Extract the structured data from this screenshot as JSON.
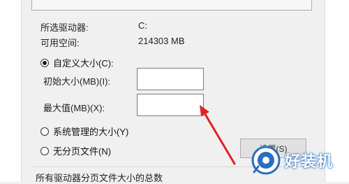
{
  "drive_info": {
    "selected_drive_label": "所选驱动器:",
    "selected_drive_value": "C:",
    "free_space_label": "可用空间:",
    "free_space_value": "214303 MB"
  },
  "custom_size": {
    "radio_label": "自定义大小(C):",
    "initial_label": "初始大小(MB)(I):",
    "initial_value": "",
    "max_label": "最大值(MB)(X):",
    "max_value": ""
  },
  "system_managed": {
    "radio_label": "系统管理的大小(Y)"
  },
  "no_paging": {
    "radio_label": "无分页文件(N)"
  },
  "set_button": {
    "label": "设置(S)"
  },
  "bottom_group": {
    "title": "所有驱动器分页文件大小的总数"
  },
  "watermark": {
    "text": "好装机",
    "icon": "logo-icon"
  },
  "colors": {
    "arrow": "#e02020",
    "watermark_blue": "#2a6ebe"
  }
}
